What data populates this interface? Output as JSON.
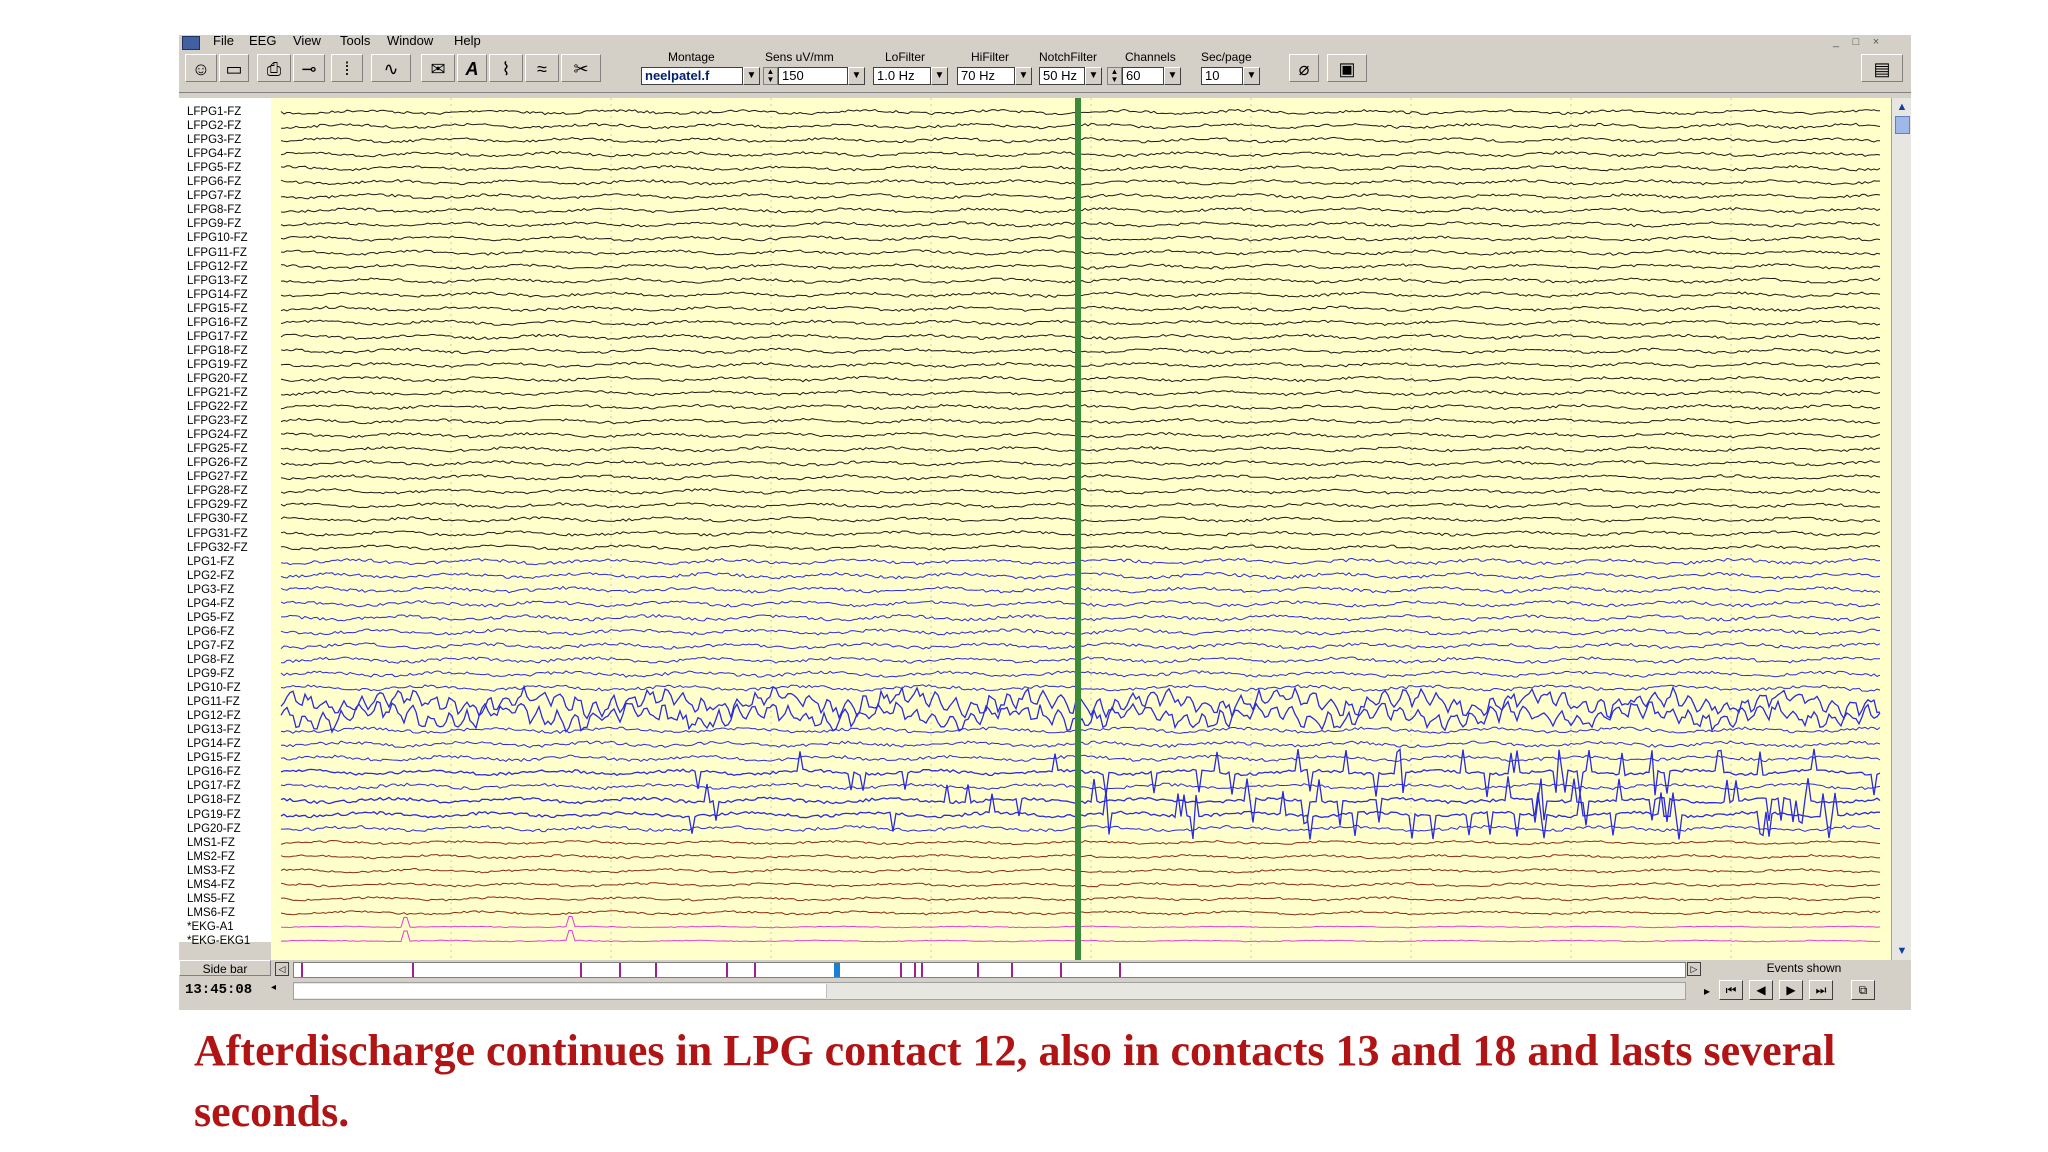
{
  "menu": [
    "File",
    "EEG",
    "View",
    "Tools",
    "Window",
    "Help"
  ],
  "window_buttons": [
    "_",
    "□",
    "×"
  ],
  "toolbar": {
    "tool_icons": [
      "person-icon",
      "open-folder-icon",
      "print-icon",
      "probe-icon",
      "columns-icon",
      "spectrum-icon",
      "envelope-icon",
      "annotate-icon",
      "spike-icon",
      "waveform-icon",
      "scissors-clipboard-icon"
    ],
    "controls": {
      "montage": {
        "label": "Montage",
        "value": "neelpatel.f"
      },
      "sens": {
        "label": "Sens uV/mm",
        "value": "150"
      },
      "lofilter": {
        "label": "LoFilter",
        "value": "1.0 Hz"
      },
      "hifilter": {
        "label": "HiFilter",
        "value": "70 Hz"
      },
      "notch": {
        "label": "NotchFilter",
        "value": "50 Hz"
      },
      "channels": {
        "label": "Channels",
        "value": "60"
      },
      "secpage": {
        "label": "Sec/page",
        "value": "10"
      }
    },
    "right_icons": [
      "paperclip-icon",
      "monitor-icon",
      "book-icon"
    ]
  },
  "channels": [
    "LFPG1-FZ",
    "LFPG2-FZ",
    "LFPG3-FZ",
    "LFPG4-FZ",
    "LFPG5-FZ",
    "LFPG6-FZ",
    "LFPG7-FZ",
    "LFPG8-FZ",
    "LFPG9-FZ",
    "LFPG10-FZ",
    "LFPG11-FZ",
    "LFPG12-FZ",
    "LFPG13-FZ",
    "LFPG14-FZ",
    "LFPG15-FZ",
    "LFPG16-FZ",
    "LFPG17-FZ",
    "LFPG18-FZ",
    "LFPG19-FZ",
    "LFPG20-FZ",
    "LFPG21-FZ",
    "LFPG22-FZ",
    "LFPG23-FZ",
    "LFPG24-FZ",
    "LFPG25-FZ",
    "LFPG26-FZ",
    "LFPG27-FZ",
    "LFPG28-FZ",
    "LFPG29-FZ",
    "LFPG30-FZ",
    "LFPG31-FZ",
    "LFPG32-FZ",
    "LPG1-FZ",
    "LPG2-FZ",
    "LPG3-FZ",
    "LPG4-FZ",
    "LPG5-FZ",
    "LPG6-FZ",
    "LPG7-FZ",
    "LPG8-FZ",
    "LPG9-FZ",
    "LPG10-FZ",
    "LPG11-FZ",
    "LPG12-FZ",
    "LPG13-FZ",
    "LPG14-FZ",
    "LPG15-FZ",
    "LPG16-FZ",
    "LPG17-FZ",
    "LPG18-FZ",
    "LPG19-FZ",
    "LPG20-FZ",
    "LMS1-FZ",
    "LMS2-FZ",
    "LMS3-FZ",
    "LMS4-FZ",
    "LMS5-FZ",
    "LMS6-FZ",
    "*EKG-A1",
    "*EKG-EKG1"
  ],
  "colors": {
    "background": "#ffffcc",
    "lfpg": "#1a1a1a",
    "lpg": "#2a2ae0",
    "lms": "#8b2a10",
    "ekg": "#e040d0",
    "marker": "#3a8a3a",
    "events": "#a0208c"
  },
  "bottom": {
    "sidebar_label": "Side bar",
    "time": "13:45:08",
    "events_label": "Events shown",
    "event_marks": [
      0.005,
      0.085,
      0.205,
      0.233,
      0.259,
      0.31,
      0.33,
      0.435,
      0.445,
      0.45,
      0.49,
      0.515,
      0.55,
      0.592
    ]
  },
  "caption": "Afterdischarge continues in LPG contact 12, also in contacts 13 and 18 and lasts several seconds."
}
